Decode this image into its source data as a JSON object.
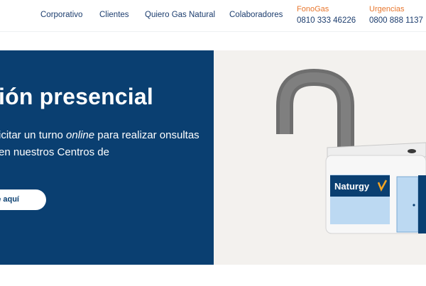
{
  "nav": {
    "items": [
      {
        "label": "Corporativo"
      },
      {
        "label": "Clientes"
      },
      {
        "label": "Quiero Gas Natural"
      },
      {
        "label": "Colaboradores"
      }
    ]
  },
  "contacts": [
    {
      "label": "FonoGas",
      "phone": "0810 333 46226"
    },
    {
      "label": "Urgencias",
      "phone": "0800 888 1137"
    }
  ],
  "hero": {
    "title": "ión presencial",
    "text_before": "icitar un turno ",
    "text_em": "online",
    "text_after": " para realizar onsultas en nuestros Centros de",
    "button_label": "e aquí"
  },
  "illustration": {
    "brand": "Naturgy",
    "icons": [
      "padlock-illustration",
      "naturgy-logo-icon"
    ]
  },
  "colors": {
    "navy": "#0a3f71",
    "orange": "#e8772e",
    "nav_text": "#1c3d6e",
    "hero_right_bg": "#f3f1ee"
  }
}
